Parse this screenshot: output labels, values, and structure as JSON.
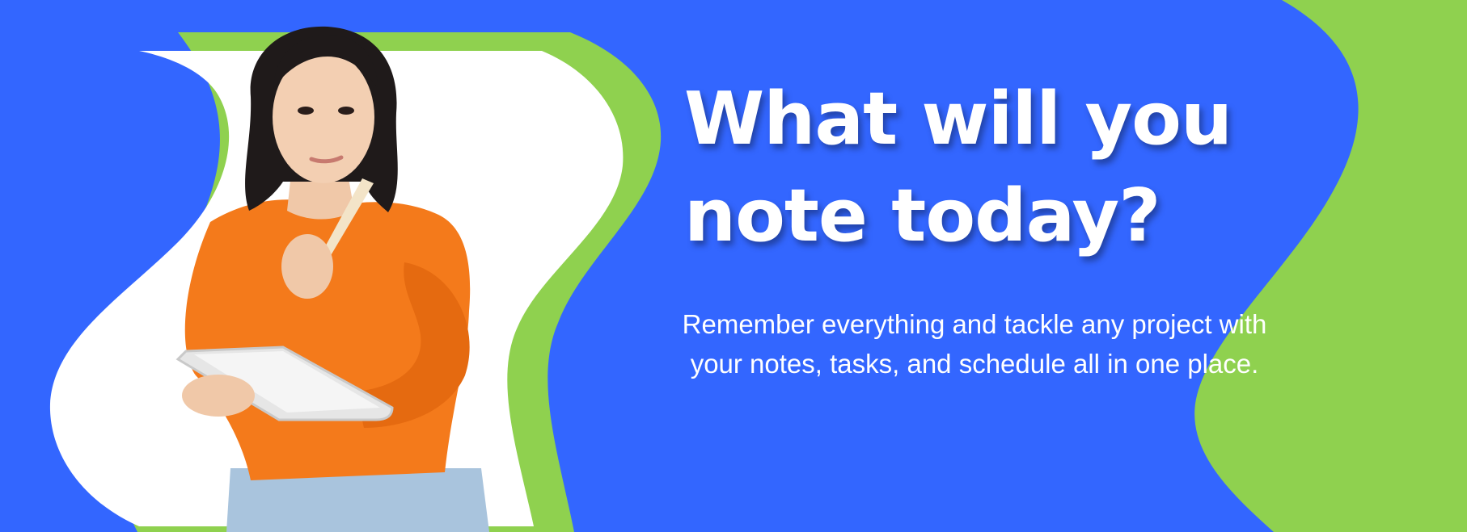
{
  "headline": {
    "line1": "What will you",
    "line2": "note today?"
  },
  "subtext": {
    "line1": "Remember everything and tackle any project with",
    "line2": "your notes, tasks, and schedule all in one place."
  },
  "colors": {
    "background": "#3366ff",
    "accent_green": "#8fd14f",
    "panel_white": "#ffffff",
    "sweater_orange": "#f47a1b",
    "text": "#ffffff"
  },
  "illustration": {
    "subject": "woman-thinking-with-tablet"
  }
}
